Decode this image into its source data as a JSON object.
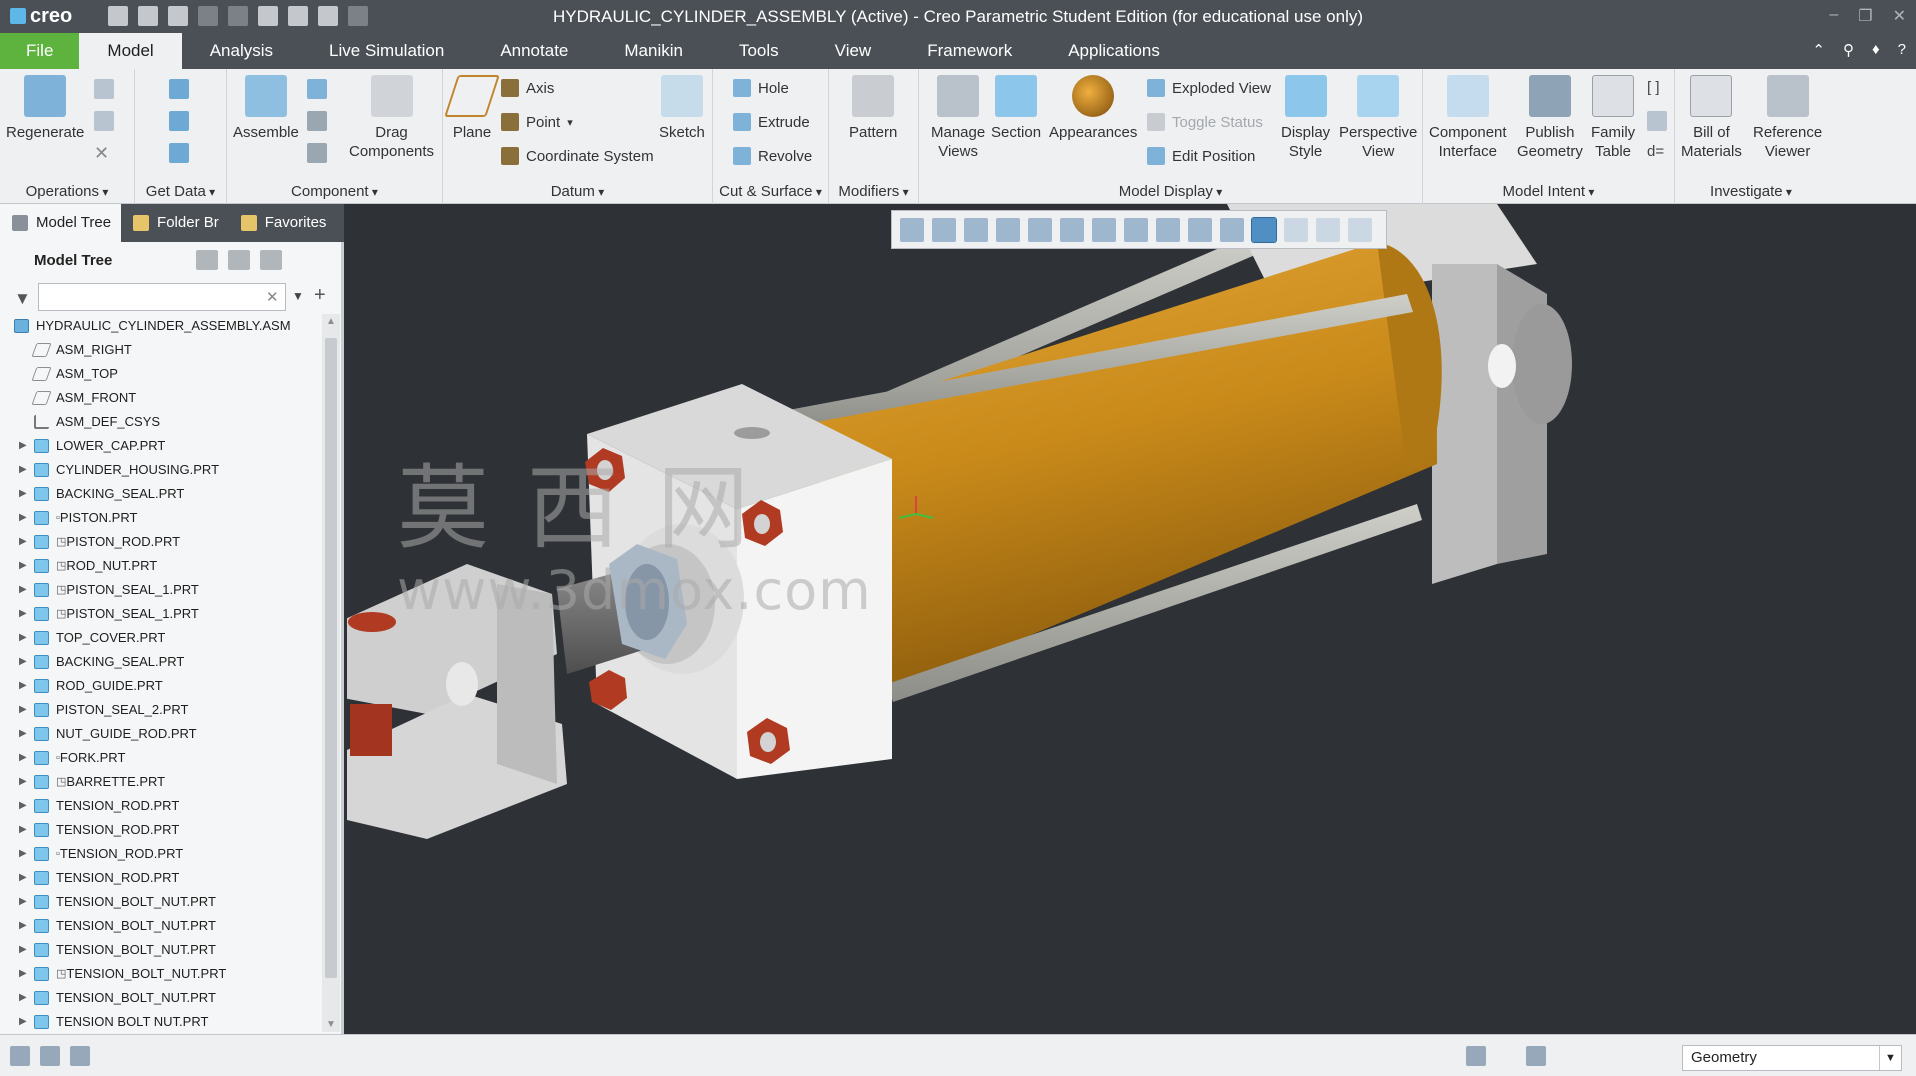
{
  "app": {
    "logo_text": "creo",
    "window_title": "HYDRAULIC_CYLINDER_ASSEMBLY (Active) - Creo Parametric Student Edition (for educational use only)"
  },
  "ribbon_tabs": [
    "File",
    "Model",
    "Analysis",
    "Live Simulation",
    "Annotate",
    "Manikin",
    "Tools",
    "View",
    "Framework",
    "Applications"
  ],
  "active_tab": "Model",
  "ribbon": {
    "regenerate": "Regenerate",
    "operations": "Operations",
    "get_data": "Get Data",
    "assemble": "Assemble",
    "drag_components": "Drag\nComponents",
    "component": "Component",
    "plane": "Plane",
    "axis": "Axis",
    "point": "Point",
    "coordinate_system": "Coordinate System",
    "sketch": "Sketch",
    "datum": "Datum",
    "hole": "Hole",
    "extrude": "Extrude",
    "revolve": "Revolve",
    "cut_surface": "Cut & Surface",
    "pattern": "Pattern",
    "modifiers": "Modifiers",
    "manage_views": "Manage\nViews",
    "section": "Section",
    "appearances": "Appearances",
    "exploded_view": "Exploded View",
    "toggle_status": "Toggle Status",
    "edit_position": "Edit Position",
    "display_style": "Display\nStyle",
    "perspective_view": "Perspective\nView",
    "model_display": "Model Display",
    "component_interface": "Component\nInterface",
    "publish_geometry": "Publish\nGeometry",
    "family_table": "Family\nTable",
    "model_intent": "Model Intent",
    "bill_of_materials": "Bill of\nMaterials",
    "reference_viewer": "Reference\nViewer",
    "investigate": "Investigate"
  },
  "panel": {
    "tabs": [
      "Model Tree",
      "Folder Br",
      "Favorites"
    ],
    "title": "Model Tree",
    "search_value": ""
  },
  "tree": [
    {
      "label": "HYDRAULIC_CYLINDER_ASSEMBLY.ASM",
      "type": "asm",
      "level": 0,
      "expand": false,
      "flag": ""
    },
    {
      "label": "ASM_RIGHT",
      "type": "datum",
      "level": 1,
      "expand": false,
      "flag": ""
    },
    {
      "label": "ASM_TOP",
      "type": "datum",
      "level": 1,
      "expand": false,
      "flag": ""
    },
    {
      "label": "ASM_FRONT",
      "type": "datum",
      "level": 1,
      "expand": false,
      "flag": ""
    },
    {
      "label": "ASM_DEF_CSYS",
      "type": "csys",
      "level": 1,
      "expand": false,
      "flag": ""
    },
    {
      "label": "LOWER_CAP.PRT",
      "type": "part",
      "level": 1,
      "expand": true,
      "flag": ""
    },
    {
      "label": "CYLINDER_HOUSING.PRT",
      "type": "part",
      "level": 1,
      "expand": true,
      "flag": ""
    },
    {
      "label": "BACKING_SEAL.PRT",
      "type": "part",
      "level": 1,
      "expand": true,
      "flag": ""
    },
    {
      "label": "PISTON.PRT",
      "type": "part",
      "level": 1,
      "expand": true,
      "flag": "▫"
    },
    {
      "label": "PISTON_ROD.PRT",
      "type": "part",
      "level": 1,
      "expand": true,
      "flag": "◳"
    },
    {
      "label": "ROD_NUT.PRT",
      "type": "part",
      "level": 1,
      "expand": true,
      "flag": "◳"
    },
    {
      "label": "PISTON_SEAL_1.PRT",
      "type": "part",
      "level": 1,
      "expand": true,
      "flag": "◳"
    },
    {
      "label": "PISTON_SEAL_1.PRT",
      "type": "part",
      "level": 1,
      "expand": true,
      "flag": "◳"
    },
    {
      "label": "TOP_COVER.PRT",
      "type": "part",
      "level": 1,
      "expand": true,
      "flag": ""
    },
    {
      "label": "BACKING_SEAL.PRT",
      "type": "part",
      "level": 1,
      "expand": true,
      "flag": ""
    },
    {
      "label": "ROD_GUIDE.PRT",
      "type": "part",
      "level": 1,
      "expand": true,
      "flag": ""
    },
    {
      "label": "PISTON_SEAL_2.PRT",
      "type": "part",
      "level": 1,
      "expand": true,
      "flag": ""
    },
    {
      "label": "NUT_GUIDE_ROD.PRT",
      "type": "part",
      "level": 1,
      "expand": true,
      "flag": ""
    },
    {
      "label": "FORK.PRT",
      "type": "part",
      "level": 1,
      "expand": true,
      "flag": "▫"
    },
    {
      "label": "BARRETTE.PRT",
      "type": "part",
      "level": 1,
      "expand": true,
      "flag": "◳"
    },
    {
      "label": "TENSION_ROD.PRT",
      "type": "part",
      "level": 1,
      "expand": true,
      "flag": ""
    },
    {
      "label": "TENSION_ROD.PRT",
      "type": "part",
      "level": 1,
      "expand": true,
      "flag": ""
    },
    {
      "label": "TENSION_ROD.PRT",
      "type": "part",
      "level": 1,
      "expand": true,
      "flag": "▫"
    },
    {
      "label": "TENSION_ROD.PRT",
      "type": "part",
      "level": 1,
      "expand": true,
      "flag": ""
    },
    {
      "label": "TENSION_BOLT_NUT.PRT",
      "type": "part",
      "level": 1,
      "expand": true,
      "flag": ""
    },
    {
      "label": "TENSION_BOLT_NUT.PRT",
      "type": "part",
      "level": 1,
      "expand": true,
      "flag": ""
    },
    {
      "label": "TENSION_BOLT_NUT.PRT",
      "type": "part",
      "level": 1,
      "expand": true,
      "flag": ""
    },
    {
      "label": "TENSION_BOLT_NUT.PRT",
      "type": "part",
      "level": 1,
      "expand": true,
      "flag": "◳"
    },
    {
      "label": "TENSION_BOLT_NUT.PRT",
      "type": "part",
      "level": 1,
      "expand": true,
      "flag": ""
    },
    {
      "label": "TENSION BOLT NUT.PRT",
      "type": "part",
      "level": 1,
      "expand": true,
      "flag": ""
    }
  ],
  "watermark": {
    "chinese": "莫西网",
    "url": "www.3dmox.com"
  },
  "status": {
    "selection_filter": "Geometry"
  },
  "colors": {
    "cylinder": "#c98a1a",
    "accent_file": "#5db33e",
    "viewport_bg": "#2e3236",
    "nut": "#b03a22"
  }
}
